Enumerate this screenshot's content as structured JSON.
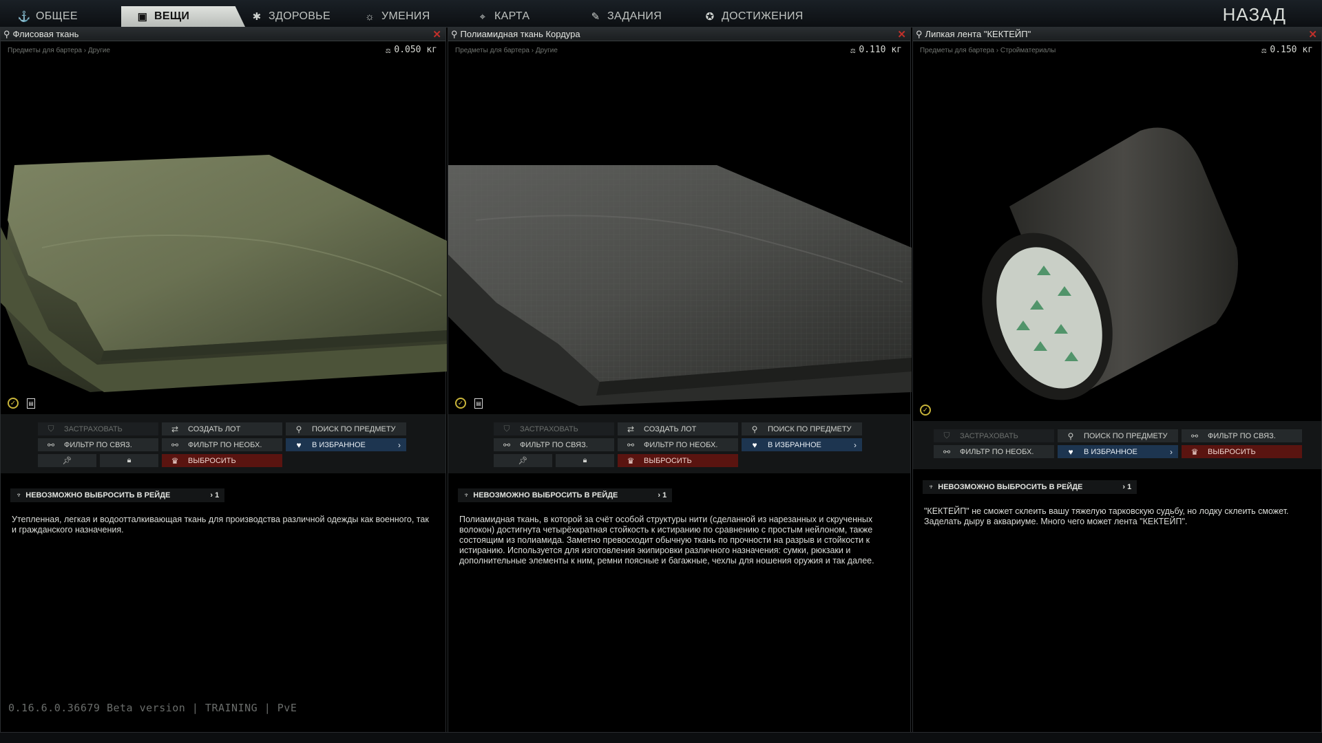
{
  "nav": {
    "tabs": [
      {
        "label": "ОБЩЕЕ",
        "icon": "anchor-icon"
      },
      {
        "label": "ВЕЩИ",
        "icon": "backpack-icon",
        "active": true
      },
      {
        "label": "ЗДОРОВЬЕ",
        "icon": "health-icon"
      },
      {
        "label": "УМЕНИЯ",
        "icon": "skills-icon"
      },
      {
        "label": "КАРТА",
        "icon": "map-pin-icon"
      },
      {
        "label": "ЗАДАНИЯ",
        "icon": "tasks-icon"
      },
      {
        "label": "ДОСТИЖЕНИЯ",
        "icon": "achievement-icon"
      }
    ],
    "back": "НАЗАД"
  },
  "panels": [
    {
      "title": "Флисовая ткань",
      "breadcrumb": "Предметы для бартера › Другие",
      "weight": "0.050 кг",
      "actions": {
        "insure": "ЗАСТРАХОВАТЬ",
        "create_lot": "СОЗДАТЬ ЛОТ",
        "search_item": "ПОИСК ПО ПРЕДМЕТУ",
        "filter_linked": "ФИЛЬТР ПО СВЯЗ.",
        "filter_needed": "ФИЛЬТР ПО НЕОБХ.",
        "favorite": "В ИЗБРАННОЕ",
        "discard": "ВЫБРОСИТЬ"
      },
      "raid_tag": "НЕВОЗМОЖНО ВЫБРОСИТЬ В РЕЙДЕ",
      "raid_count": "› 1",
      "description": "Утепленная, легкая и водоотталкивающая ткань для производства различной одежды как военного, так и гражданского назначения."
    },
    {
      "title": "Полиамидная ткань Кордура",
      "breadcrumb": "Предметы для бартера › Другие",
      "weight": "0.110 кг",
      "actions": {
        "insure": "ЗАСТРАХОВАТЬ",
        "create_lot": "СОЗДАТЬ ЛОТ",
        "search_item": "ПОИСК ПО ПРЕДМЕТУ",
        "filter_linked": "ФИЛЬТР ПО СВЯЗ.",
        "filter_needed": "ФИЛЬТР ПО НЕОБХ.",
        "favorite": "В ИЗБРАННОЕ",
        "discard": "ВЫБРОСИТЬ"
      },
      "raid_tag": "НЕВОЗМОЖНО ВЫБРОСИТЬ В РЕЙДЕ",
      "raid_count": "› 1",
      "description": "Полиамидная ткань, в которой за счёт особой структуры нити (сделанной из нарезанных и скрученных волокон) достигнута четырёхкратная стойкость к истиранию по сравнению с простым нейлоном, также состоящим из полиамида. Заметно превосходит обычную ткань по прочности на разрыв и стойкости к истиранию. Используется для изготовления экипировки различного назначения: сумки, рюкзаки и дополнительные элементы к ним, ремни поясные и багажные, чехлы для ношения оружия и так далее."
    },
    {
      "title": "Липкая лента \"КЕКТЕЙП\"",
      "breadcrumb": "Предметы для бартера › Стройматериалы",
      "weight": "0.150 кг",
      "actions": {
        "insure": "ЗАСТРАХОВАТЬ",
        "search_item": "ПОИСК ПО ПРЕДМЕТУ",
        "filter_linked": "ФИЛЬТР ПО СВЯЗ.",
        "filter_needed": "ФИЛЬТР ПО НЕОБХ.",
        "favorite": "В ИЗБРАННОЕ",
        "discard": "ВЫБРОСИТЬ"
      },
      "raid_tag": "НЕВОЗМОЖНО ВЫБРОСИТЬ В РЕЙДЕ",
      "raid_count": "› 1",
      "description": "\"КЕКТЕЙП\" не сможет склеить вашу тяжелую тарковскую судьбу, но лодку склеить сможет. Заделать дыру в аквариуме. Много чего может лента \"КЕКТЕЙП\"."
    }
  ],
  "version": "0.16.6.0.36679 Beta version | TRAINING | PvE",
  "colors": {
    "fleece": "#6f7658",
    "cordura": "#4a4b4a",
    "tape": "#3c3b38",
    "favorite": "#1d3550",
    "discard": "#5a1410",
    "close": "#c0302a"
  }
}
